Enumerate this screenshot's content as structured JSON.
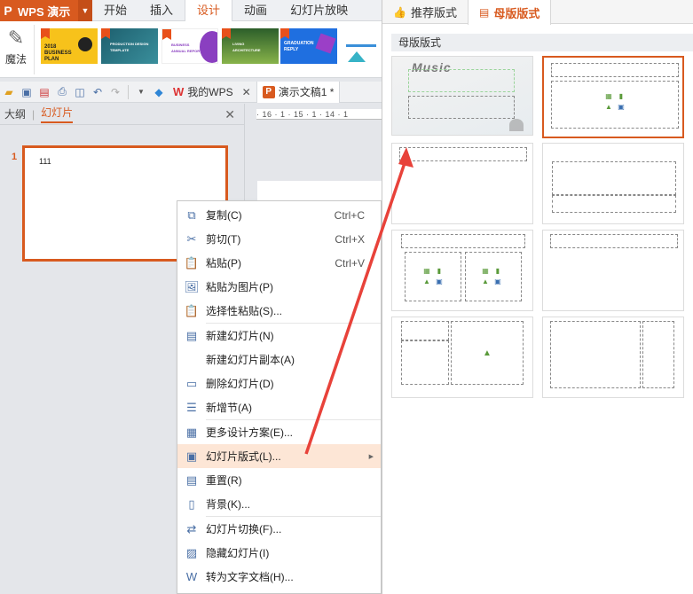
{
  "app": {
    "name": "WPS 演示"
  },
  "ribbon_tabs": [
    "开始",
    "插入",
    "设计",
    "动画",
    "幻灯片放映"
  ],
  "ribbon_active_tab": "设计",
  "ribbon": {
    "magic_label": "魔法",
    "templates": [
      {
        "title": "2018 BUSINESS PLAN",
        "bg": "#f7c21b"
      },
      {
        "title": "PRODUCTION DESIGN TEMPLATE",
        "bg": "#2d7a88"
      },
      {
        "title": "BUSINESS ANNUAL REPORT",
        "bg": "#ffffff"
      },
      {
        "title": "LIVING ARCHITECTURE",
        "bg": "#2c5e2a"
      },
      {
        "title": "GRADUATION REPLY",
        "bg": "#1f6fe0"
      },
      {
        "title": "",
        "bg": "#ffffff"
      }
    ]
  },
  "quick_access": {
    "my_wps": "我的WPS",
    "doc_title": "演示文稿1 *"
  },
  "panel": {
    "tab_outline": "大纲",
    "tab_slides": "幻灯片",
    "slide_number": "1",
    "slide_text": "111"
  },
  "ruler": {
    "marks": "· 16 · 1 · 15 · 1 · 14 · 1"
  },
  "context_menu": [
    {
      "label": "复制(C)",
      "shortcut": "Ctrl+C",
      "icon": "copy-icon",
      "glyph": "⧉"
    },
    {
      "label": "剪切(T)",
      "shortcut": "Ctrl+X",
      "icon": "scissors-icon",
      "glyph": "✂"
    },
    {
      "label": "粘贴(P)",
      "shortcut": "Ctrl+V",
      "icon": "paste-icon",
      "glyph": "📋"
    },
    {
      "label": "粘贴为图片(P)",
      "shortcut": "",
      "icon": "paste-image-icon",
      "glyph": "🖼"
    },
    {
      "label": "选择性粘贴(S)...",
      "shortcut": "",
      "icon": "paste-special-icon",
      "glyph": "📋"
    },
    {
      "sep": true
    },
    {
      "label": "新建幻灯片(N)",
      "shortcut": "",
      "icon": "new-slide-icon",
      "glyph": "▤"
    },
    {
      "label": "新建幻灯片副本(A)",
      "shortcut": "",
      "icon": "",
      "glyph": ""
    },
    {
      "label": "删除幻灯片(D)",
      "shortcut": "",
      "icon": "delete-slide-icon",
      "glyph": "▭"
    },
    {
      "label": "新增节(A)",
      "shortcut": "",
      "icon": "new-section-icon",
      "glyph": "☰"
    },
    {
      "sep": true
    },
    {
      "label": "更多设计方案(E)...",
      "shortcut": "",
      "icon": "design-icon",
      "glyph": "▦"
    },
    {
      "label": "幻灯片版式(L)...",
      "shortcut": "",
      "icon": "layout-icon",
      "glyph": "▣",
      "submenu": true,
      "highlight": true
    },
    {
      "label": "重置(R)",
      "shortcut": "",
      "icon": "reset-icon",
      "glyph": "▤"
    },
    {
      "label": "背景(K)...",
      "shortcut": "",
      "icon": "background-icon",
      "glyph": "▯"
    },
    {
      "sep": true
    },
    {
      "label": "幻灯片切换(F)...",
      "shortcut": "",
      "icon": "transition-icon",
      "glyph": "⇄"
    },
    {
      "label": "隐藏幻灯片(I)",
      "shortcut": "",
      "icon": "hide-slide-icon",
      "glyph": "▨"
    },
    {
      "label": "转为文字文档(H)...",
      "shortcut": "",
      "icon": "convert-doc-icon",
      "glyph": "W"
    }
  ],
  "gallery": {
    "tabs": [
      "推荐版式",
      "母版版式"
    ],
    "active_tab": "母版版式",
    "section_title": "母版版式",
    "master_preview_text": "Music"
  },
  "colors": {
    "accent": "#d85a1f",
    "highlight": "#fde6d6",
    "arrow": "#e8423a"
  }
}
